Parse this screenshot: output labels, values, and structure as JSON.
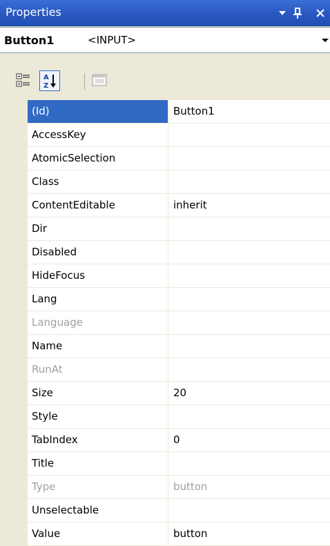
{
  "window": {
    "title": "Properties",
    "icons": [
      "dropdown-arrow-icon",
      "pin-icon",
      "close-icon"
    ]
  },
  "selector": {
    "object_name": "Button1",
    "object_type": "<INPUT>"
  },
  "toolbar": {
    "buttons": [
      "categorized-icon",
      "alphabetical-icon",
      "property-pages-icon"
    ],
    "active": "alphabetical-icon"
  },
  "properties": [
    {
      "name": "(Id)",
      "value": "Button1",
      "selected": true
    },
    {
      "name": "AccessKey",
      "value": ""
    },
    {
      "name": "AtomicSelection",
      "value": ""
    },
    {
      "name": "Class",
      "value": ""
    },
    {
      "name": "ContentEditable",
      "value": "inherit"
    },
    {
      "name": "Dir",
      "value": ""
    },
    {
      "name": "Disabled",
      "value": ""
    },
    {
      "name": "HideFocus",
      "value": ""
    },
    {
      "name": "Lang",
      "value": ""
    },
    {
      "name": "Language",
      "value": "",
      "disabled": true
    },
    {
      "name": "Name",
      "value": ""
    },
    {
      "name": "RunAt",
      "value": "",
      "disabled": true
    },
    {
      "name": "Size",
      "value": "20"
    },
    {
      "name": "Style",
      "value": ""
    },
    {
      "name": "TabIndex",
      "value": "0"
    },
    {
      "name": "Title",
      "value": ""
    },
    {
      "name": "Type",
      "value": "button",
      "disabled": true
    },
    {
      "name": "Unselectable",
      "value": ""
    },
    {
      "name": "Value",
      "value": "button"
    }
  ],
  "colors": {
    "title_bar": "#2a57c0",
    "selection": "#316ac5",
    "disabled_text": "#a0a0a0",
    "chrome": "#ece9d8"
  }
}
